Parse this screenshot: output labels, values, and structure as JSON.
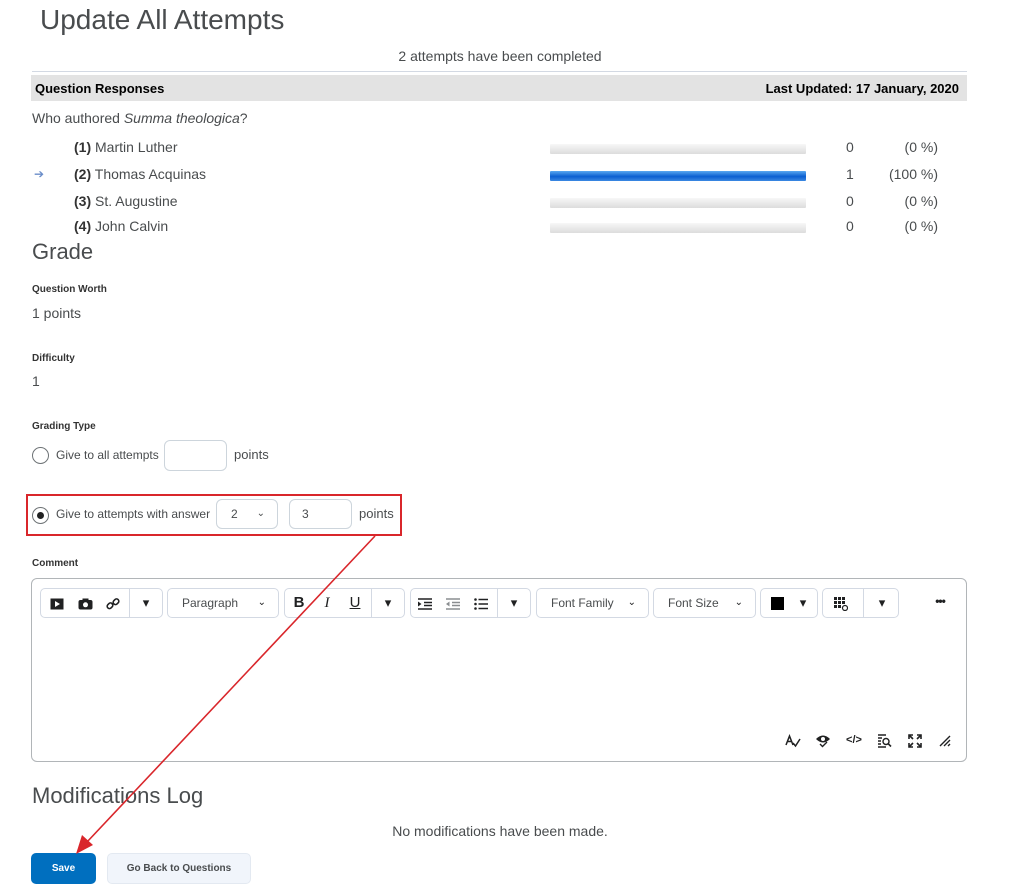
{
  "title": "Update All Attempts",
  "summary": "2 attempts have been completed",
  "responses": {
    "header": "Question Responses",
    "last_updated": "Last Updated: 17 January, 2020",
    "question_prefix": "Who authored ",
    "question_emph": "Summa theologica",
    "question_suffix": "?",
    "options": [
      {
        "num": "(1)",
        "text": "Martin Luther",
        "count": "0",
        "percent": "(0 %)",
        "fraction": 0,
        "selected": false
      },
      {
        "num": "(2)",
        "text": "Thomas Acquinas",
        "count": "1",
        "percent": "(100 %)",
        "fraction": 1,
        "selected": true
      },
      {
        "num": "(3)",
        "text": "St. Augustine",
        "count": "0",
        "percent": "(0 %)",
        "fraction": 0,
        "selected": false
      },
      {
        "num": "(4)",
        "text": "John Calvin",
        "count": "0",
        "percent": "(0 %)",
        "fraction": 0,
        "selected": false
      }
    ]
  },
  "grade": {
    "heading": "Grade",
    "worth_label": "Question Worth",
    "worth_value": "1 points",
    "difficulty_label": "Difficulty",
    "difficulty_value": "1",
    "grading_type_label": "Grading Type",
    "option_all_label": "Give to all attempts",
    "option_all_value": "",
    "option_answer_label": "Give to attempts with answer",
    "answer_select_value": "2",
    "answer_points_value": "3",
    "points_label": "points"
  },
  "comment": {
    "label": "Comment",
    "toolbar": {
      "format_select": "Paragraph",
      "font_family": "Font Family",
      "font_size": "Font Size",
      "bold": "B",
      "italic": "I",
      "underline": "U",
      "more": "•••"
    }
  },
  "modifications": {
    "heading": "Modifications Log",
    "empty_text": "No modifications have been made."
  },
  "buttons": {
    "save": "Save",
    "back": "Go Back to Questions"
  },
  "colors": {
    "primary": "#006fbf",
    "annotation": "#d9262b",
    "bar_fill": "#0b5fd1"
  }
}
